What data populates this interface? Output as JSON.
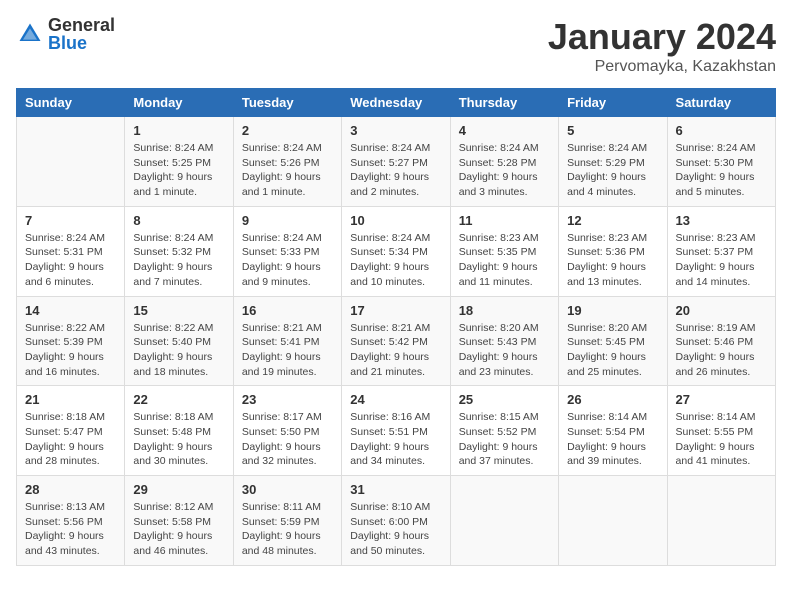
{
  "header": {
    "logo_general": "General",
    "logo_blue": "Blue",
    "month_title": "January 2024",
    "subtitle": "Pervomayka, Kazakhstan"
  },
  "weekdays": [
    "Sunday",
    "Monday",
    "Tuesday",
    "Wednesday",
    "Thursday",
    "Friday",
    "Saturday"
  ],
  "weeks": [
    [
      {
        "day": "",
        "info": ""
      },
      {
        "day": "1",
        "info": "Sunrise: 8:24 AM\nSunset: 5:25 PM\nDaylight: 9 hours\nand 1 minute."
      },
      {
        "day": "2",
        "info": "Sunrise: 8:24 AM\nSunset: 5:26 PM\nDaylight: 9 hours\nand 1 minute."
      },
      {
        "day": "3",
        "info": "Sunrise: 8:24 AM\nSunset: 5:27 PM\nDaylight: 9 hours\nand 2 minutes."
      },
      {
        "day": "4",
        "info": "Sunrise: 8:24 AM\nSunset: 5:28 PM\nDaylight: 9 hours\nand 3 minutes."
      },
      {
        "day": "5",
        "info": "Sunrise: 8:24 AM\nSunset: 5:29 PM\nDaylight: 9 hours\nand 4 minutes."
      },
      {
        "day": "6",
        "info": "Sunrise: 8:24 AM\nSunset: 5:30 PM\nDaylight: 9 hours\nand 5 minutes."
      }
    ],
    [
      {
        "day": "7",
        "info": "Sunrise: 8:24 AM\nSunset: 5:31 PM\nDaylight: 9 hours\nand 6 minutes."
      },
      {
        "day": "8",
        "info": "Sunrise: 8:24 AM\nSunset: 5:32 PM\nDaylight: 9 hours\nand 7 minutes."
      },
      {
        "day": "9",
        "info": "Sunrise: 8:24 AM\nSunset: 5:33 PM\nDaylight: 9 hours\nand 9 minutes."
      },
      {
        "day": "10",
        "info": "Sunrise: 8:24 AM\nSunset: 5:34 PM\nDaylight: 9 hours\nand 10 minutes."
      },
      {
        "day": "11",
        "info": "Sunrise: 8:23 AM\nSunset: 5:35 PM\nDaylight: 9 hours\nand 11 minutes."
      },
      {
        "day": "12",
        "info": "Sunrise: 8:23 AM\nSunset: 5:36 PM\nDaylight: 9 hours\nand 13 minutes."
      },
      {
        "day": "13",
        "info": "Sunrise: 8:23 AM\nSunset: 5:37 PM\nDaylight: 9 hours\nand 14 minutes."
      }
    ],
    [
      {
        "day": "14",
        "info": "Sunrise: 8:22 AM\nSunset: 5:39 PM\nDaylight: 9 hours\nand 16 minutes."
      },
      {
        "day": "15",
        "info": "Sunrise: 8:22 AM\nSunset: 5:40 PM\nDaylight: 9 hours\nand 18 minutes."
      },
      {
        "day": "16",
        "info": "Sunrise: 8:21 AM\nSunset: 5:41 PM\nDaylight: 9 hours\nand 19 minutes."
      },
      {
        "day": "17",
        "info": "Sunrise: 8:21 AM\nSunset: 5:42 PM\nDaylight: 9 hours\nand 21 minutes."
      },
      {
        "day": "18",
        "info": "Sunrise: 8:20 AM\nSunset: 5:43 PM\nDaylight: 9 hours\nand 23 minutes."
      },
      {
        "day": "19",
        "info": "Sunrise: 8:20 AM\nSunset: 5:45 PM\nDaylight: 9 hours\nand 25 minutes."
      },
      {
        "day": "20",
        "info": "Sunrise: 8:19 AM\nSunset: 5:46 PM\nDaylight: 9 hours\nand 26 minutes."
      }
    ],
    [
      {
        "day": "21",
        "info": "Sunrise: 8:18 AM\nSunset: 5:47 PM\nDaylight: 9 hours\nand 28 minutes."
      },
      {
        "day": "22",
        "info": "Sunrise: 8:18 AM\nSunset: 5:48 PM\nDaylight: 9 hours\nand 30 minutes."
      },
      {
        "day": "23",
        "info": "Sunrise: 8:17 AM\nSunset: 5:50 PM\nDaylight: 9 hours\nand 32 minutes."
      },
      {
        "day": "24",
        "info": "Sunrise: 8:16 AM\nSunset: 5:51 PM\nDaylight: 9 hours\nand 34 minutes."
      },
      {
        "day": "25",
        "info": "Sunrise: 8:15 AM\nSunset: 5:52 PM\nDaylight: 9 hours\nand 37 minutes."
      },
      {
        "day": "26",
        "info": "Sunrise: 8:14 AM\nSunset: 5:54 PM\nDaylight: 9 hours\nand 39 minutes."
      },
      {
        "day": "27",
        "info": "Sunrise: 8:14 AM\nSunset: 5:55 PM\nDaylight: 9 hours\nand 41 minutes."
      }
    ],
    [
      {
        "day": "28",
        "info": "Sunrise: 8:13 AM\nSunset: 5:56 PM\nDaylight: 9 hours\nand 43 minutes."
      },
      {
        "day": "29",
        "info": "Sunrise: 8:12 AM\nSunset: 5:58 PM\nDaylight: 9 hours\nand 46 minutes."
      },
      {
        "day": "30",
        "info": "Sunrise: 8:11 AM\nSunset: 5:59 PM\nDaylight: 9 hours\nand 48 minutes."
      },
      {
        "day": "31",
        "info": "Sunrise: 8:10 AM\nSunset: 6:00 PM\nDaylight: 9 hours\nand 50 minutes."
      },
      {
        "day": "",
        "info": ""
      },
      {
        "day": "",
        "info": ""
      },
      {
        "day": "",
        "info": ""
      }
    ]
  ]
}
